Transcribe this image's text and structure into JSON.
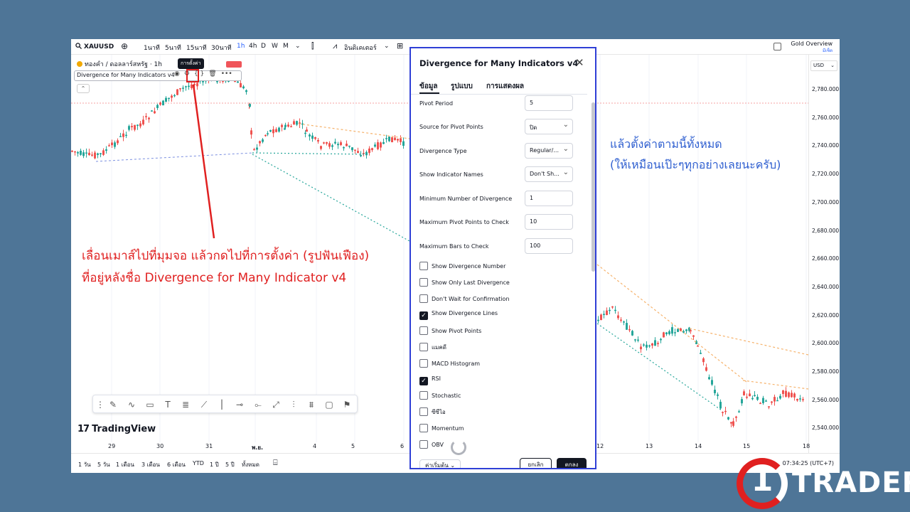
{
  "toolbar": {
    "symbol": "XAUUSD",
    "intervals": [
      "1นาที",
      "5นาที",
      "15นาที",
      "30นาที",
      "1h",
      "4h",
      "D",
      "W",
      "M"
    ],
    "active_interval": "1h",
    "indicators_label": "อินดิเคเตอร์",
    "gold_title": "Gold Overview",
    "gold_sub": "มีเซ็ต"
  },
  "legend": {
    "symbol_line": "ทองคำ / ดอลลาร์สหรัฐ · 1h",
    "indicator_name": "Divergence for Many Indicators v4",
    "tooltip": "การตั้งค่า"
  },
  "price_axis": {
    "currency": "USD",
    "labels": [
      "2,780.000",
      "2,760.000",
      "2,740.000",
      "2,720.000",
      "2,700.000",
      "2,680.000",
      "2,660.000",
      "2,640.000",
      "2,620.000",
      "2,600.000",
      "2,580.000",
      "2,560.000",
      "2,540.000"
    ]
  },
  "date_axis": [
    "29",
    "30",
    "31",
    "พ.ย.",
    "4",
    "5",
    "6",
    "12",
    "13",
    "14",
    "15",
    "18"
  ],
  "bottom_bar": {
    "ranges": [
      "1 วัน",
      "5 วัน",
      "1 เดือน",
      "3 เดือน",
      "6 เดือน",
      "YTD",
      "1 ปี",
      "5 ปี",
      "ทั้งหมด"
    ],
    "clock": "07:34:25 (UTC+7)"
  },
  "branding": {
    "tradingview": "TradingView",
    "logo_text": "TRADER",
    "logo_mark": "1"
  },
  "annotations": {
    "red_line1": "เลื่อนเมาส์ไปที่มุมจอ แล้วกดไปที่การตั้งค่า (รูปฟันเฟือง)",
    "red_line2": "ที่อยู่หลังชื่อ Divergence for Many Indicator v4",
    "blue_line1": "แล้วตั้งค่าตามนี้ทั้งหมด",
    "blue_line2": "(ให้เหมือนเป๊ะๆทุกอย่างเลยนะครับ)"
  },
  "dialog": {
    "title": "Divergence for Many Indicators v4",
    "tabs": [
      "ข้อมูล",
      "รูปแบบ",
      "การแสดงผล"
    ],
    "fields": [
      {
        "label": "Pivot Period",
        "value": "5"
      },
      {
        "label": "Source for Pivot Points",
        "value": "ปิด"
      },
      {
        "label": "Divergence Type",
        "value": "Regular/..."
      },
      {
        "label": "Show Indicator Names",
        "value": "Don't Sh..."
      },
      {
        "label": "Minimum Number of Divergence",
        "value": "1"
      },
      {
        "label": "Maximum Pivot Points to Check",
        "value": "10"
      },
      {
        "label": "Maximum Bars to Check",
        "value": "100"
      }
    ],
    "checkboxes": [
      {
        "label": "Show Divergence Number",
        "checked": false
      },
      {
        "label": "Show Only Last Divergence",
        "checked": false
      },
      {
        "label": "Don't Wait for Confirmation",
        "checked": false
      },
      {
        "label": "Show Divergence Lines",
        "checked": true
      },
      {
        "label": "Show Pivot Points",
        "checked": false
      },
      {
        "label": "แมคดี",
        "checked": false
      },
      {
        "label": "MACD Histogram",
        "checked": false
      },
      {
        "label": "RSI",
        "checked": true
      },
      {
        "label": "Stochastic",
        "checked": false
      },
      {
        "label": "ซีซีไอ",
        "checked": false
      },
      {
        "label": "Momentum",
        "checked": false
      },
      {
        "label": "OBV",
        "checked": false
      }
    ],
    "footer": {
      "default": "ค่าเริ่มต้น",
      "cancel": "ยกเลิก",
      "ok": "ตกลง"
    }
  },
  "colors": {
    "up": "#26a69a",
    "down": "#ef5350",
    "annotation_red": "#e02020",
    "annotation_blue": "#2f5fd0",
    "dialog_border": "#2f3fd6",
    "background": "#4e7597"
  }
}
